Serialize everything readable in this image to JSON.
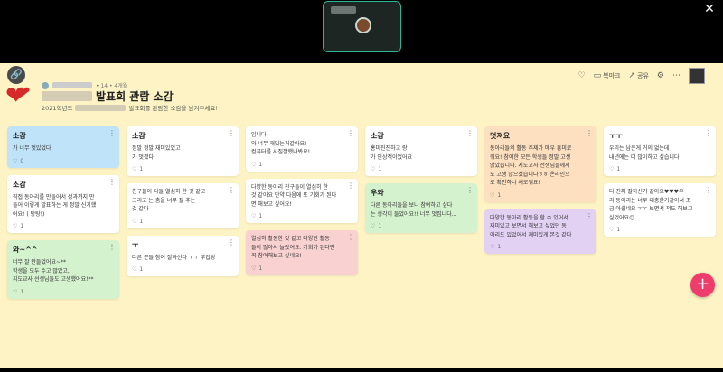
{
  "video": {
    "participant_icon": "avatar"
  },
  "toolbar": {
    "bookmark": "북마크",
    "share": "공유"
  },
  "header": {
    "meta": "• 14  • 4개월",
    "title": "발표회 관람 소감",
    "subtitle_prefix": "2021학년도",
    "subtitle_suffix": "발표회를 관람한 소감을 남겨주세요!"
  },
  "columns": [
    [
      {
        "color": "blue",
        "title": "소감",
        "lines": [
          "가 너무 멋있었다"
        ],
        "likes": "0"
      },
      {
        "color": "white",
        "title": "소감",
        "lines": [
          "직접 동아리를 만들어서 성과까지 만",
          "들어 이렇게 발표하는 게 정말 신기했",
          "어요! (  탕탕!)"
        ],
        "likes": "1"
      },
      {
        "color": "green",
        "title": "와~^^",
        "lines": [
          "너무 잘 만들었어요~**",
          "학생을 모두 수고 많았고,",
          "지도교사 선생님들도 고생했어요!**"
        ],
        "likes": "1"
      }
    ],
    [
      {
        "color": "white",
        "title": "소감",
        "lines": [
          "정말 정말 재미있었고",
          "가 멋졌다"
        ],
        "likes": "1"
      },
      {
        "color": "white",
        "title": "",
        "lines": [
          "친구들이 다들 열심히 한 것 같고",
          "그리고  는 춤을 너무 잘 추는",
          "것 같다"
        ],
        "likes": "1"
      },
      {
        "color": "white",
        "title": "ㅜ",
        "lines": [
          "다른 분들 참여 잘하신다 ㅜㅜ 부럽당"
        ],
        "likes": "1"
      }
    ],
    [
      {
        "color": "white",
        "title": "",
        "lines": [
          "입니다",
          "와 너무 재밌는거같아요!",
          "컴퓨터를 사질잘했나봐요!"
        ],
        "likes": "1"
      },
      {
        "color": "white",
        "title": "",
        "lines": [
          "다양한 동아리 친구들이 열심히 한",
          "것 같아요 만약 다음에 또 기회가 된다",
          "면 해보고 싶어요!"
        ],
        "likes": "1"
      },
      {
        "color": "pink",
        "title": "",
        "lines": [
          "열심히 활동한 것 같고 다양한 활동",
          "들이 많아서 놀랐어요. 기회가 된다면",
          "꼭 참여해보고 싶네요!"
        ],
        "likes": "1"
      }
    ],
    [
      {
        "color": "white",
        "title": "소감",
        "lines": [
          "홍미진진하고  랑",
          "가 인상적이었어요"
        ],
        "likes": "1"
      },
      {
        "color": "green",
        "title": "우와",
        "lines": [
          "다른 동아리들을 보니 참여하고 싶다",
          "는 생각이 들었어요!! 너무 멋집니다..."
        ],
        "likes": "1"
      }
    ],
    [
      {
        "color": "orange",
        "title": "멋져요",
        "lines": [
          "동아리들의 활동 주제가 매우 흥미로",
          "워요! 참여한 모든 학생들 정말 고생",
          "많았습니다. 지도교사 선생님들께서",
          "도 고생 많으셨습니다ㅎㅎ 온라인으",
          "로 확인하니 새로워요!"
        ],
        "likes": "1"
      },
      {
        "color": "purple",
        "title": "",
        "lines": [
          "다양한 동아리 활동을 할 수 있어서",
          "재미있고 보면서 해보고 싶었던 동",
          "아리도 있었어서 재미있게 본것 같다"
        ],
        "likes": "1"
      }
    ],
    [
      {
        "color": "white",
        "title": "ㅜㅜ",
        "lines": [
          "우리는 남은게 거의 없는데",
          "내년에는 더 많이하고 싶습니다"
        ],
        "likes": "1"
      },
      {
        "color": "white",
        "title": "",
        "lines": [
          "다 진짜 잘하신거 같아요♥♥♥우",
          "리 동아리는 너무 대충한거같아서 조",
          "금 아쉽네요 ㅜㅜ 보면서 저도 해보고",
          "싶었어요😊"
        ],
        "likes": "1"
      }
    ]
  ]
}
